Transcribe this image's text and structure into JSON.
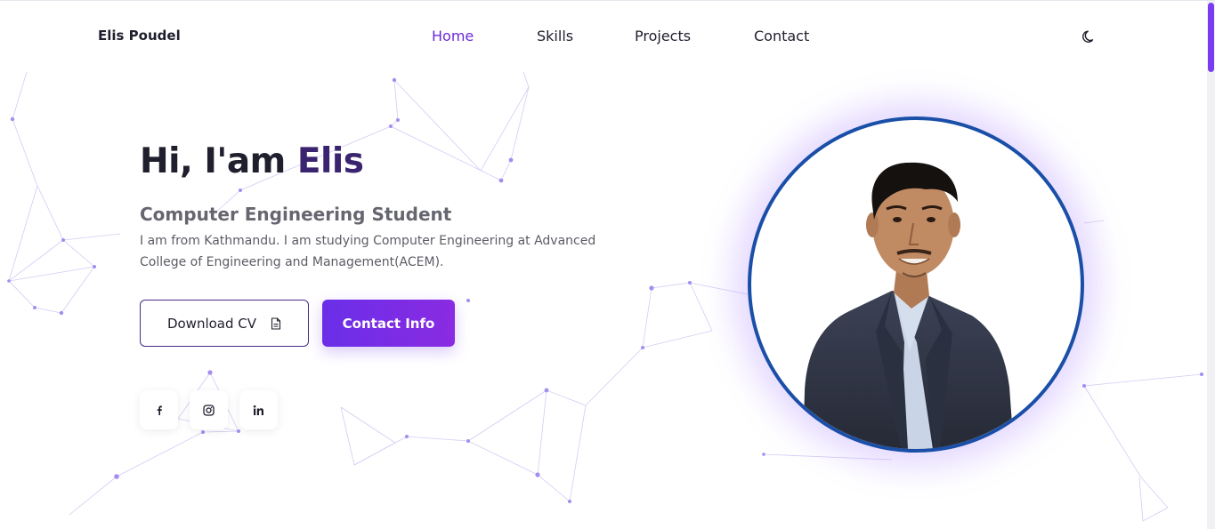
{
  "nav": {
    "brand": "Elis Poudel",
    "links": [
      {
        "label": "Home",
        "active": true
      },
      {
        "label": "Skills",
        "active": false
      },
      {
        "label": "Projects",
        "active": false
      },
      {
        "label": "Contact",
        "active": false
      }
    ],
    "theme_toggle_icon": "moon-icon"
  },
  "hero": {
    "greeting_prefix": "Hi, I'am ",
    "greeting_name": "Elis",
    "subtitle": "Computer Engineering Student",
    "bio": "I am from Kathmandu. I am studying Computer Engineering at Advanced College of Engineering and Management(ACEM).",
    "download_cv_label": "Download CV",
    "download_cv_icon": "document-icon",
    "contact_info_label": "Contact Info",
    "socials": [
      {
        "icon": "facebook-icon"
      },
      {
        "icon": "instagram-icon"
      },
      {
        "icon": "linkedin-icon"
      }
    ]
  },
  "profile": {
    "photo_icon": "profile-photo"
  },
  "colors": {
    "accent": "#6b2bd9",
    "button_gradient_start": "#6a2ee8",
    "button_gradient_end": "#8a2be2",
    "frame_border": "#1a4fa8",
    "name_color": "#3a2470"
  }
}
